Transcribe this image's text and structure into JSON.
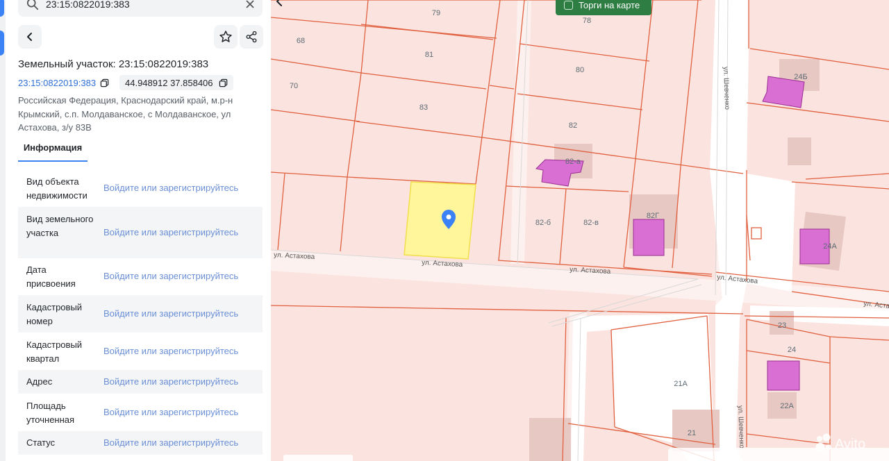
{
  "search": {
    "value": "23:15:0822019:383"
  },
  "header": {
    "title": "Земельный участок: 23:15:0822019:383"
  },
  "parcel": {
    "cadastral_link": "23:15:0822019:383",
    "coordinates": "44.948912 37.858406",
    "address": "Российская Федерация, Краснодарский край, м.р-н Крымский, с.п. Молдаванское, с Молдаванское, ул Астахова, з/у 83В"
  },
  "tabs": {
    "info": "Информация"
  },
  "info_rows": [
    {
      "label": "Вид объекта недвижимости",
      "value": "Войдите или зарегистрируйтесь"
    },
    {
      "label": "Вид земельного участка",
      "value": "Войдите или зарегистрируйтесь"
    },
    {
      "label": "Дата присвоения",
      "value": "Войдите или зарегистрируйтесь"
    },
    {
      "label": "Кадастровый номер",
      "value": "Войдите или зарегистрируйтесь"
    },
    {
      "label": "Кадастровый квартал",
      "value": "Войдите или зарегистрируйтесь"
    },
    {
      "label": "Адрес",
      "value": "Войдите или зарегистрируйтесь"
    },
    {
      "label": "Площадь уточненная",
      "value": "Войдите или зарегистрируйтесь"
    },
    {
      "label": "Статус",
      "value": "Войдите или зарегистрируйтесь"
    }
  ],
  "map": {
    "auction_button": "Торги на карте",
    "parcel_labels": [
      "79",
      "68",
      "81",
      "70",
      "83",
      "78",
      "80",
      "82",
      "82-а",
      "82-б",
      "82-в",
      "82Г",
      "24Б",
      "24А",
      "23",
      "24",
      "21А",
      "22А",
      "21"
    ],
    "street_labels": [
      "ул. Астахова",
      "ул. Астахова",
      "ул. Астахова",
      "ул. Астахова",
      "ул. Астахова",
      "ул. Шевченко",
      "ул. Шевченко"
    ],
    "watermark": "Avito"
  },
  "colors": {
    "accent": "#3b82f6",
    "link": "#2f6fd6",
    "parcel_fill": "#fbe3df",
    "parcel_line": "#e0603f",
    "selected_fill": "#fff59a",
    "building": "#d96fd3",
    "green_button": "#2e7d43"
  }
}
